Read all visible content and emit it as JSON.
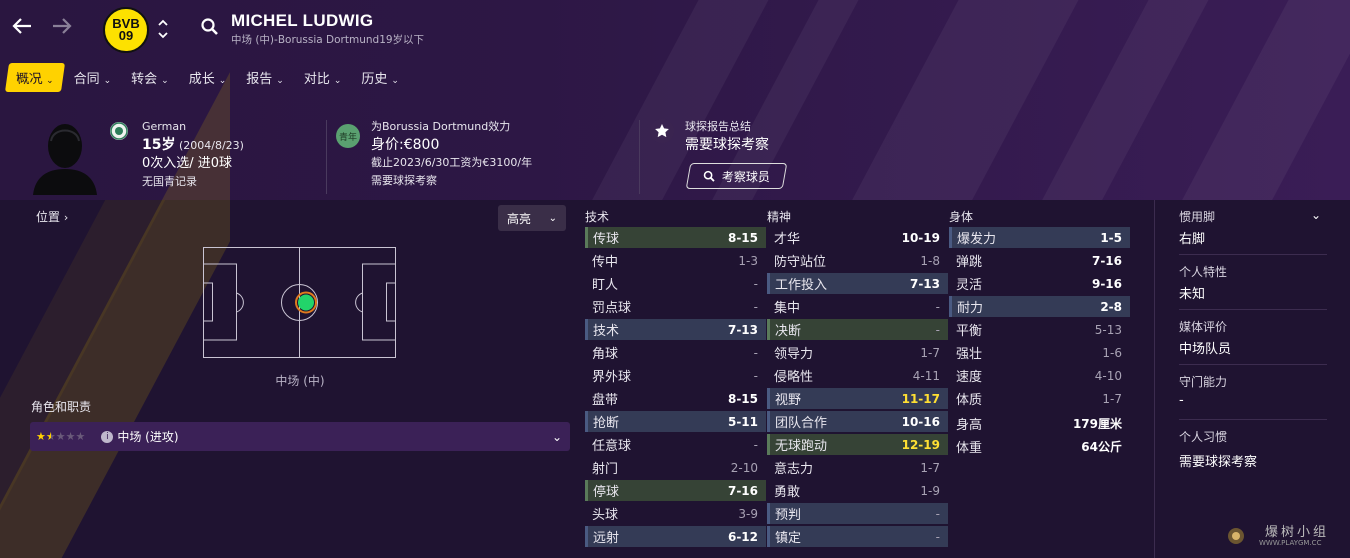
{
  "header": {
    "club_logo_text_top": "BVB",
    "club_logo_text_bottom": "09",
    "player_name": "MICHEL LUDWIG",
    "player_subtitle": "中场 (中)-Borussia Dortmund19岁以下"
  },
  "menu": [
    {
      "label": "概况",
      "active": true
    },
    {
      "label": "合同",
      "active": false
    },
    {
      "label": "转会",
      "active": false
    },
    {
      "label": "成长",
      "active": false
    },
    {
      "label": "报告",
      "active": false
    },
    {
      "label": "对比",
      "active": false
    },
    {
      "label": "历史",
      "active": false
    }
  ],
  "profile": {
    "nationality": "German",
    "age": "15岁",
    "dob": "(2004/8/23)",
    "caps": "0次入选/ 进0球",
    "youth_record": "无国青记录"
  },
  "club_info": {
    "badge": "青年",
    "playing_for": "为Borussia Dortmund效力",
    "value": "身价:€800",
    "contract": "截止2023/6/30工资为€3100/年",
    "note": "需要球探考察"
  },
  "scout": {
    "title": "球探报告总结",
    "summary": "需要球探考察",
    "button": "考察球员"
  },
  "position_panel": {
    "label": "位置",
    "highlight_select": "高亮",
    "position_name": "中场 (中)",
    "roles_label": "角色和职责",
    "role": "中场 (进攻)",
    "role_stars": 1.5,
    "role_stars_max": 5
  },
  "attributes": {
    "technical": {
      "title": "技术",
      "items": [
        {
          "name": "传球",
          "value": "8-15",
          "hl": "g"
        },
        {
          "name": "传中",
          "value": "1-3",
          "hl": ""
        },
        {
          "name": "盯人",
          "value": "-",
          "hl": ""
        },
        {
          "name": "罚点球",
          "value": "-",
          "hl": ""
        },
        {
          "name": "技术",
          "value": "7-13",
          "hl": "b"
        },
        {
          "name": "角球",
          "value": "-",
          "hl": ""
        },
        {
          "name": "界外球",
          "value": "-",
          "hl": ""
        },
        {
          "name": "盘带",
          "value": "8-15",
          "hl": ""
        },
        {
          "name": "抢断",
          "value": "5-11",
          "hl": "b"
        },
        {
          "name": "任意球",
          "value": "-",
          "hl": ""
        },
        {
          "name": "射门",
          "value": "2-10",
          "hl": ""
        },
        {
          "name": "停球",
          "value": "7-16",
          "hl": "g"
        },
        {
          "name": "头球",
          "value": "3-9",
          "hl": ""
        },
        {
          "name": "远射",
          "value": "6-12",
          "hl": "b"
        }
      ]
    },
    "mental": {
      "title": "精神",
      "items": [
        {
          "name": "才华",
          "value": "10-19",
          "hl": ""
        },
        {
          "name": "防守站位",
          "value": "1-8",
          "hl": ""
        },
        {
          "name": "工作投入",
          "value": "7-13",
          "hl": "b"
        },
        {
          "name": "集中",
          "value": "-",
          "hl": ""
        },
        {
          "name": "决断",
          "value": "-",
          "hl": "g"
        },
        {
          "name": "领导力",
          "value": "1-7",
          "hl": ""
        },
        {
          "name": "侵略性",
          "value": "4-11",
          "hl": ""
        },
        {
          "name": "视野",
          "value": "11-17",
          "hl": "b",
          "yellow": true
        },
        {
          "name": "团队合作",
          "value": "10-16",
          "hl": "b"
        },
        {
          "name": "无球跑动",
          "value": "12-19",
          "hl": "g",
          "yellow": true
        },
        {
          "name": "意志力",
          "value": "1-7",
          "hl": ""
        },
        {
          "name": "勇敢",
          "value": "1-9",
          "hl": ""
        },
        {
          "name": "预判",
          "value": "-",
          "hl": "b"
        },
        {
          "name": "镇定",
          "value": "-",
          "hl": "b"
        }
      ]
    },
    "physical": {
      "title": "身体",
      "items": [
        {
          "name": "爆发力",
          "value": "1-5",
          "hl": "b"
        },
        {
          "name": "弹跳",
          "value": "7-16",
          "hl": ""
        },
        {
          "name": "灵活",
          "value": "9-16",
          "hl": ""
        },
        {
          "name": "耐力",
          "value": "2-8",
          "hl": "b"
        },
        {
          "name": "平衡",
          "value": "5-13",
          "hl": ""
        },
        {
          "name": "强壮",
          "value": "1-6",
          "hl": ""
        },
        {
          "name": "速度",
          "value": "4-10",
          "hl": ""
        },
        {
          "name": "体质",
          "value": "1-7",
          "hl": ""
        }
      ],
      "height_label": "身高",
      "height": "179厘米",
      "weight_label": "体重",
      "weight": "64公斤"
    }
  },
  "right_panel": [
    {
      "label": "惯用脚",
      "value": "右脚"
    },
    {
      "label": "个人特性",
      "value": "未知"
    },
    {
      "label": "媒体评价",
      "value": "中场队员"
    },
    {
      "label": "守门能力",
      "value": "-"
    },
    {
      "label": "个人习惯",
      "value": "需要球探考察"
    }
  ],
  "watermark": {
    "text": "爆树小组",
    "url": "WWW.PLAYGM.CC"
  },
  "colors": {
    "accent": "#ffd200",
    "bg": "#1f1331",
    "header": "#2d1745",
    "pos_dot": "#22d46a"
  }
}
